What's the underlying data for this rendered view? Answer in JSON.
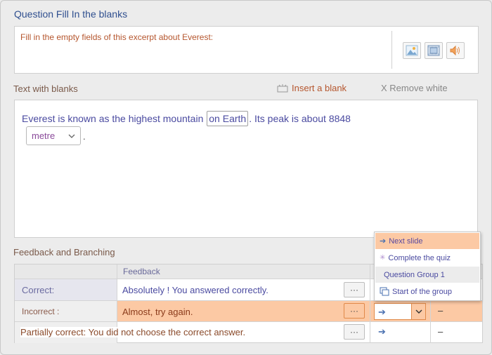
{
  "question": {
    "title": "Question Fill In the blanks",
    "text": "Fill in the empty fields of this excerpt about Everest:"
  },
  "media_buttons": [
    {
      "icon": "image-icon"
    },
    {
      "icon": "video-icon"
    },
    {
      "icon": "audio-icon"
    }
  ],
  "blanks_section": {
    "label": "Text with blanks",
    "insert_blank": "Insert a blank",
    "remove_white": "X Remove white"
  },
  "editor": {
    "part1": "Everest is known as the highest mountain ",
    "blank_word": "on Earth",
    "part2": ". Its peak is about 8848",
    "dropdown_value": "metre",
    "period": "."
  },
  "feedback": {
    "title": "Feedback and Branching",
    "column_header": "Feedback",
    "rows": [
      {
        "label": "Correct:",
        "text": "Absolutely ! You answered correctly.",
        "dots": "···"
      },
      {
        "label": "Incorrect :",
        "text": "Almost, try again.",
        "dots": "···",
        "arrow": "➔",
        "dash": "–"
      },
      {
        "label": "Partially correct: You did not choose the correct answer.",
        "text": "",
        "dots": "···",
        "arrow": "➔",
        "dash": "–"
      }
    ]
  },
  "branch_menu": {
    "items": [
      {
        "label": "Next slide",
        "icon": "arrow-right-icon"
      },
      {
        "label": "Complete the quiz",
        "icon": "sparkle-icon"
      },
      {
        "label": "Question Group 1",
        "icon": ""
      },
      {
        "label": "Start of the group",
        "icon": "copy-icon"
      }
    ]
  },
  "colors": {
    "highlight": "#fcc9a4",
    "accent_orange": "#e08a4a",
    "link_blue": "#4a4aa0"
  }
}
